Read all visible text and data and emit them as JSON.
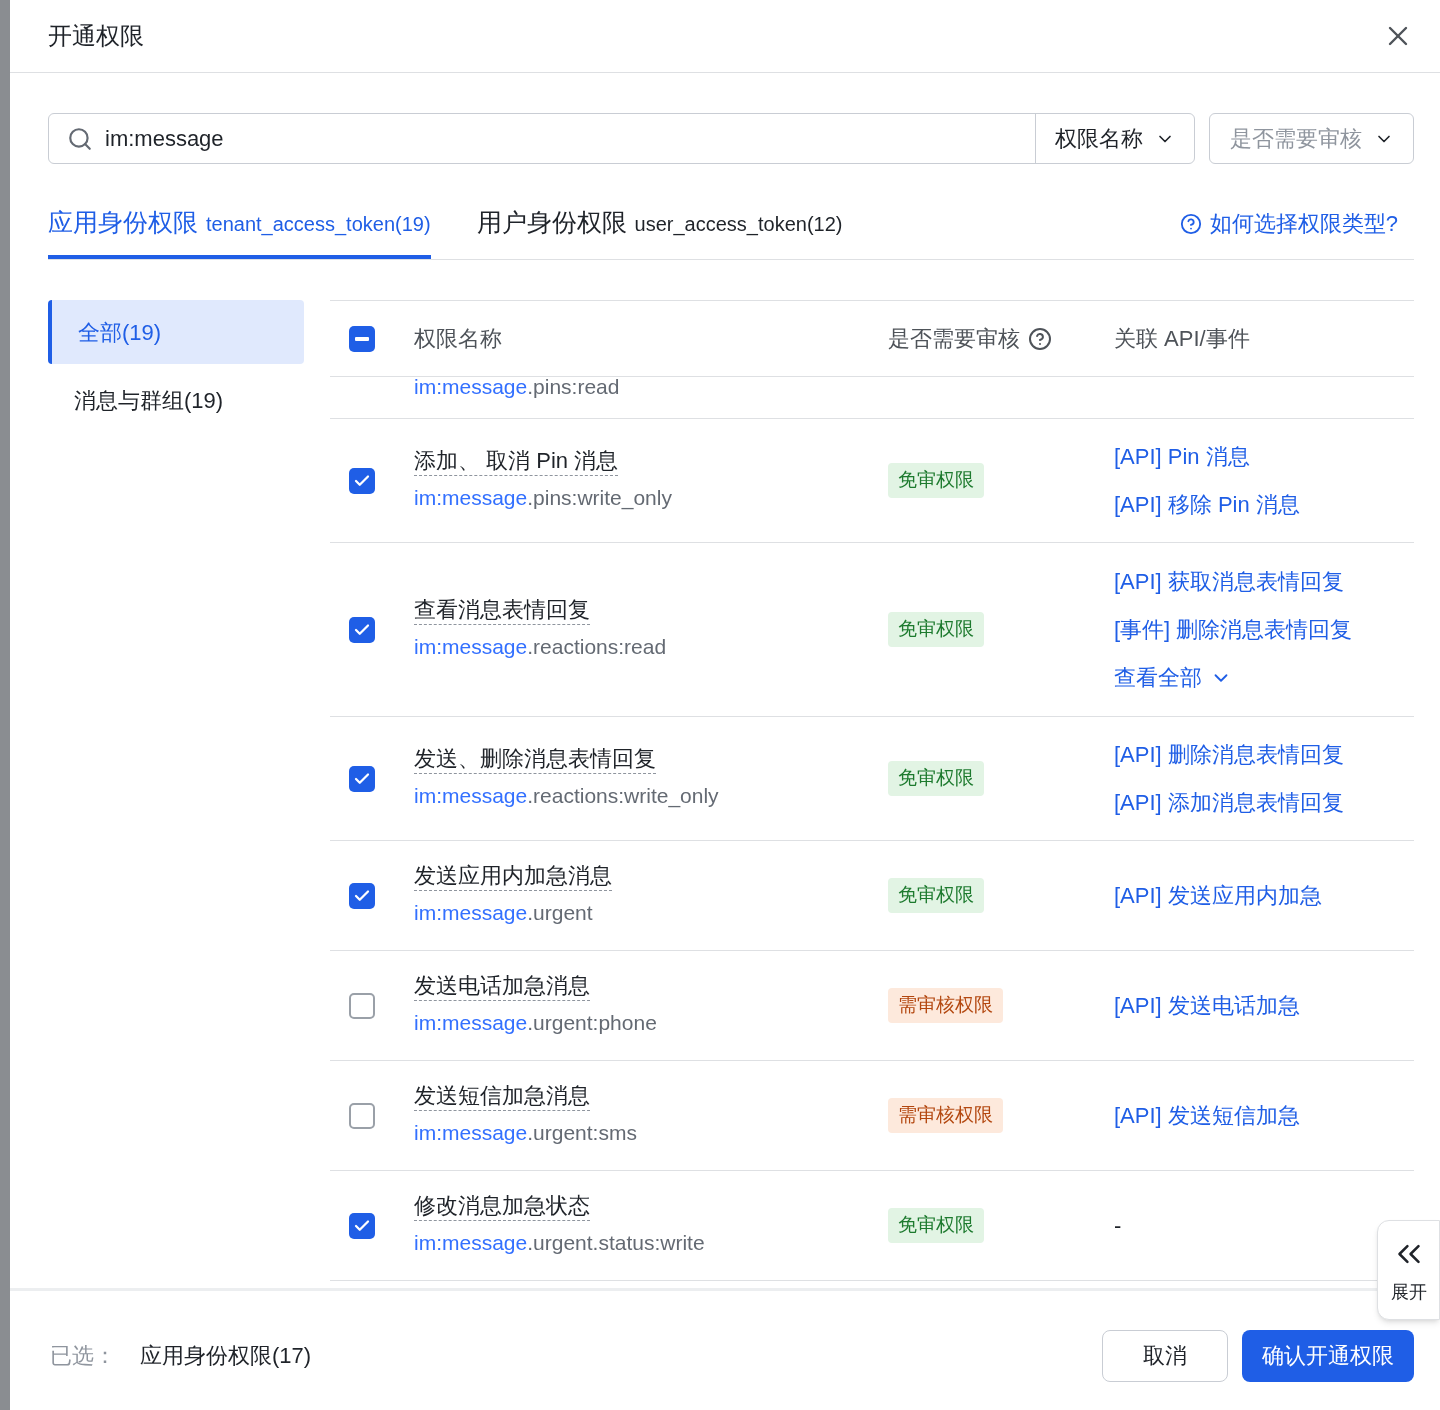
{
  "title": "开通权限",
  "search": {
    "value": "im:message"
  },
  "filters": [
    {
      "label": "权限名称",
      "placeholder": false
    },
    {
      "label": "是否需要审核",
      "placeholder": true
    }
  ],
  "tabs": [
    {
      "label": "应用身份权限",
      "token": "tenant_access_token(19)",
      "selected": true
    },
    {
      "label": "用户身份权限",
      "token": "user_access_token(12)",
      "selected": false
    }
  ],
  "help_link": "如何选择权限类型?",
  "categories": [
    {
      "label": "全部(19)",
      "selected": true
    },
    {
      "label": "消息与群组(19)",
      "selected": false
    }
  ],
  "table": {
    "select_all": {
      "checked": true,
      "indeterminate": true
    },
    "columns": [
      "权限名称",
      "是否需要审核",
      "关联 API/事件"
    ],
    "partial_row": {
      "match": "im:message",
      "rest": ".pins:read"
    },
    "rows": [
      {
        "checked": true,
        "name": "添加、 取消 Pin 消息",
        "match": "im:message",
        "rest": ".pins:write_only",
        "badge": {
          "kind": "free",
          "label": "免审权限"
        },
        "apis": [
          "[API] Pin 消息",
          "[API] 移除 Pin 消息"
        ]
      },
      {
        "checked": true,
        "name": "查看消息表情回复",
        "match": "im:message",
        "rest": ".reactions:read",
        "badge": {
          "kind": "free",
          "label": "免审权限"
        },
        "apis": [
          "[API] 获取消息表情回复",
          "[事件] 删除消息表情回复"
        ],
        "more": "查看全部"
      },
      {
        "checked": true,
        "name": "发送、删除消息表情回复",
        "match": "im:message",
        "rest": ".reactions:write_only",
        "badge": {
          "kind": "free",
          "label": "免审权限"
        },
        "apis": [
          "[API] 删除消息表情回复",
          "[API] 添加消息表情回复"
        ]
      },
      {
        "checked": true,
        "name": "发送应用内加急消息",
        "match": "im:message",
        "rest": ".urgent",
        "badge": {
          "kind": "free",
          "label": "免审权限"
        },
        "apis": [
          "[API] 发送应用内加急"
        ]
      },
      {
        "checked": false,
        "name": "发送电话加急消息",
        "match": "im:message",
        "rest": ".urgent:phone",
        "badge": {
          "kind": "review",
          "label": "需审核权限"
        },
        "apis": [
          "[API] 发送电话加急"
        ]
      },
      {
        "checked": false,
        "name": "发送短信加急消息",
        "match": "im:message",
        "rest": ".urgent:sms",
        "badge": {
          "kind": "review",
          "label": "需审核权限"
        },
        "apis": [
          "[API] 发送短信加急"
        ]
      },
      {
        "checked": true,
        "name": "修改消息加急状态",
        "match": "im:message",
        "rest": ".urgent.status:write",
        "badge": {
          "kind": "free",
          "label": "免审权限"
        },
        "none": "-"
      }
    ]
  },
  "footer": {
    "label": "已选：",
    "value": "应用身份权限(17)",
    "buttons": [
      {
        "kind": "secondary",
        "label": "取消"
      },
      {
        "kind": "primary",
        "label": "确认开通权限"
      }
    ]
  },
  "expand_panel": {
    "label": "展开"
  }
}
